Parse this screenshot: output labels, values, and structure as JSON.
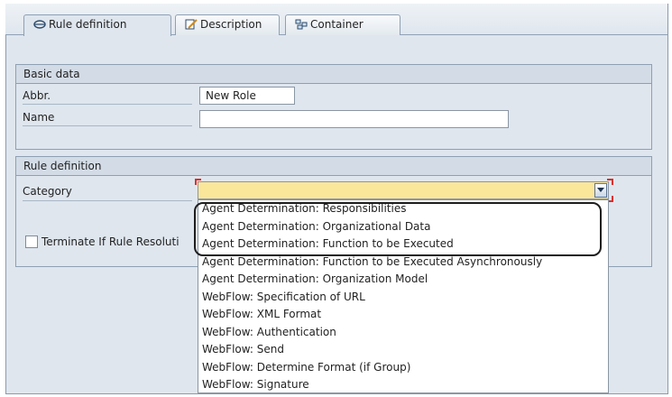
{
  "tabs": [
    {
      "label": "Rule definition",
      "icon": "rule-definition-icon",
      "active": true
    },
    {
      "label": "Description",
      "icon": "description-icon",
      "active": false
    },
    {
      "label": "Container",
      "icon": "container-icon",
      "active": false
    }
  ],
  "basic_data": {
    "title": "Basic data",
    "abbr_label": "Abbr.",
    "abbr_value": "New Role",
    "name_label": "Name",
    "name_value": ""
  },
  "rule_definition": {
    "title": "Rule definition",
    "category_label": "Category",
    "category_value": "",
    "terminate_label": "Terminate If Rule Resoluti",
    "terminate_checked": false
  },
  "dropdown": {
    "options": [
      "Agent Determination: Responsibilities",
      "Agent Determination: Organizational Data",
      "Agent Determination: Function to be Executed",
      "Agent Determination: Function to be Executed Asynchronously",
      "Agent Determination: Organization Model",
      "WebFlow: Specification of URL",
      "WebFlow: XML Format",
      "WebFlow: Authentication",
      "WebFlow: Send",
      "WebFlow: Determine Format (if Group)",
      "WebFlow: Signature"
    ]
  },
  "colors": {
    "background": "#dfe6ee",
    "required_input": "#fbe79a",
    "required_marker": "#d9302c",
    "highlight_border": "#1e1e1e"
  }
}
